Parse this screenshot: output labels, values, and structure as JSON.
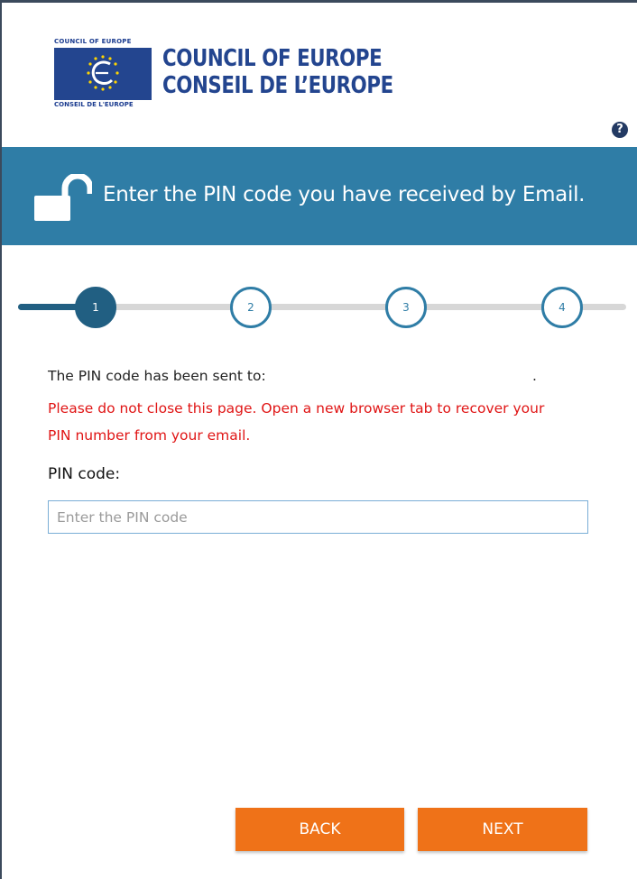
{
  "logo": {
    "small_top": "COUNCIL OF EUROPE",
    "small_bottom": "CONSEIL DE L'EUROPE",
    "title_line1": "COUNCIL OF EUROPE",
    "title_line2": "CONSEIL DE L’EUROPE"
  },
  "help": {
    "icon": "question-circle-icon",
    "glyph": "?"
  },
  "banner": {
    "icon": "unlocked-padlock-icon",
    "text": "Enter the PIN code you have received by Email."
  },
  "stepper": {
    "steps": [
      {
        "label": "1",
        "active": true
      },
      {
        "label": "2",
        "active": false
      },
      {
        "label": "3",
        "active": false
      },
      {
        "label": "4",
        "active": false
      }
    ]
  },
  "content": {
    "sent_text": "The PIN code has been sent to:",
    "sent_dot": ".",
    "warning": "Please do not close this page. Open a new browser tab to recover your PIN number from your email.",
    "pin_label": "PIN code:",
    "pin_placeholder": "Enter the PIN code",
    "pin_value": ""
  },
  "buttons": {
    "back": "BACK",
    "next": "NEXT"
  },
  "colors": {
    "banner": "#2f7da6",
    "step_active": "#215f82",
    "warning": "#e01515",
    "button": "#ef7218",
    "logo_blue": "#23458f"
  }
}
